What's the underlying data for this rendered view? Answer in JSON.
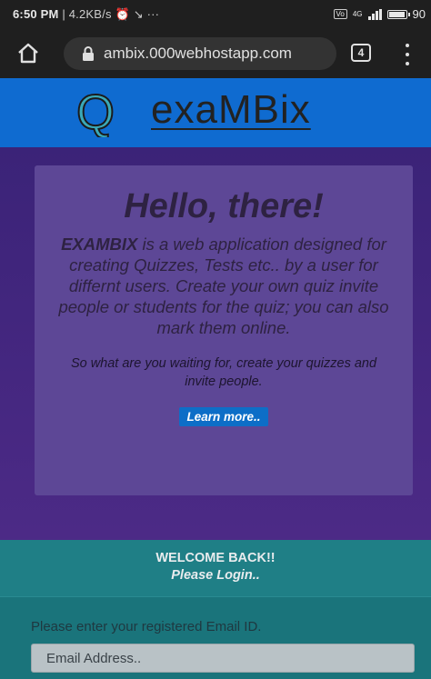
{
  "status_bar": {
    "time": "6:50 PM",
    "speed": "| 4.2KB/s",
    "extra": "···",
    "network": "4G",
    "battery": "90"
  },
  "browser": {
    "url": "ambix.000webhostapp.com",
    "tab_count": "4"
  },
  "site": {
    "logo_letter": "Q",
    "brand": "exaMBix",
    "colors": {
      "header": "#0f6bd0",
      "hero_card": "#5d4796",
      "welcome": "#1f7f86",
      "accent_button": "#0d6ec7"
    }
  },
  "hero": {
    "title": "Hello, there!",
    "brand_name": "EXAMBIX",
    "description": " is a web application designed for creating Quizzes, Tests etc.. by a user for differnt users. Create your own quiz invite people or students for the quiz; you can also mark them online.",
    "cta": "So what are you waiting for, create your quizzes and invite people.",
    "learn_more": "Learn more.."
  },
  "welcome": {
    "line1": "WELCOME BACK!!",
    "line2": "Please Login.."
  },
  "login": {
    "email_label": "Please enter your registered Email ID.",
    "email_placeholder": "Email Address.."
  }
}
